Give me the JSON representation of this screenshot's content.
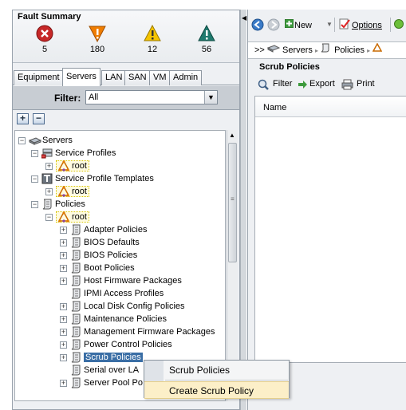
{
  "fault_summary": {
    "title": "Fault Summary",
    "faults": [
      {
        "severity": "critical",
        "icon": "critical-fault-icon",
        "count": "5",
        "color": "#c62828"
      },
      {
        "severity": "major",
        "icon": "major-fault-icon",
        "count": "180",
        "color": "#f07d00"
      },
      {
        "severity": "minor",
        "icon": "minor-fault-icon",
        "count": "12",
        "color": "#f5c400"
      },
      {
        "severity": "warning",
        "icon": "warning-fault-icon",
        "count": "56",
        "color": "#1f7a6e"
      }
    ]
  },
  "tabs": [
    "Equipment",
    "Servers",
    "LAN",
    "SAN",
    "VM",
    "Admin"
  ],
  "active_tab": "Servers",
  "filter": {
    "label": "Filter:",
    "value": "All"
  },
  "tree": {
    "servers": "Servers",
    "service_profiles": "Service Profiles",
    "root": "root",
    "service_profile_templates": "Service Profile Templates",
    "policies": "Policies",
    "policy_items": [
      "Adapter Policies",
      "BIOS Defaults",
      "BIOS Policies",
      "Boot Policies",
      "Host Firmware Packages",
      "IPMI Access Profiles",
      "Local Disk Config Policies",
      "Maintenance Policies",
      "Management Firmware Packages",
      "Power Control Policies",
      "Scrub Policies",
      "Serial over LA",
      "Server Pool Po"
    ],
    "selected": "Scrub Policies"
  },
  "right_pane": {
    "toolbar": {
      "new_label": "New",
      "options_label": "Options"
    },
    "breadcrumb": {
      "prefix": ">>",
      "items": [
        "Servers",
        "Policies"
      ]
    },
    "section_title": "Scrub Policies",
    "actions": {
      "filter": "Filter",
      "export": "Export",
      "print": "Print"
    },
    "table": {
      "columns": [
        "Name"
      ]
    }
  },
  "context_menu": {
    "title_item": "Scrub Policies",
    "action_item": "Create Scrub Policy",
    "highlight_color": "#fcefc8"
  }
}
